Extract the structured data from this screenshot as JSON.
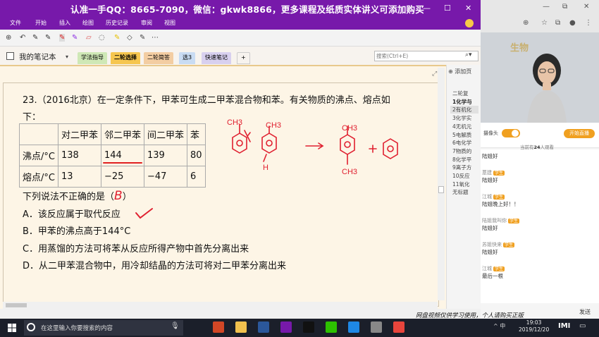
{
  "window": {
    "banner_title": "认准一手QQ：8665-7090，微信：gkwk8866，更多课程及纸质实体讲义可添加购买",
    "controls": [
      "—",
      "☐",
      "✕"
    ]
  },
  "menu": [
    "文件",
    "开始",
    "插入",
    "绘图",
    "历史记录",
    "审阅",
    "视图"
  ],
  "notebook": {
    "name": "我的笔记本",
    "tabs": [
      {
        "label": "学法指导",
        "color": "#cfe8b6"
      },
      {
        "label": "二轮选择",
        "color": "#f6c64f"
      },
      {
        "label": "二轮简答",
        "color": "#f3cda2"
      },
      {
        "label": "选3",
        "color": "#c9dcf3"
      },
      {
        "label": "快速笔记",
        "color": "#d8d0ef"
      },
      {
        "label": "+",
        "color": "#f7f3ee"
      }
    ],
    "search_placeholder": "搜索(Ctrl+E)"
  },
  "question": {
    "stem_line1": "23.（2016北京）在一定条件下，甲苯可生成二甲苯混合物和苯。有关物质的沸点、熔点如",
    "stem_line2": "下：",
    "table": {
      "header": [
        "",
        "对二甲苯",
        "邻二甲苯",
        "间二甲苯",
        "苯"
      ],
      "rows": [
        [
          "沸点/°C",
          "138",
          "144",
          "139",
          "80"
        ],
        [
          "熔点/°C",
          "13",
          "−25",
          "−47",
          "6"
        ]
      ]
    },
    "prompt": "下列说法不正确的是（",
    "prompt_end": "）",
    "answer_handwritten": "B",
    "options": [
      "A．该反应属于取代反应",
      "B．甲苯的沸点高于144°C",
      "C．用蒸馏的方法可将苯从反应所得产物中首先分离出来",
      "D．从二甲苯混合物中，用冷却结晶的方法可将对二甲苯分离出来"
    ],
    "sketch_labels": [
      "CH3",
      "CH3",
      "H",
      "CH3",
      "CH3"
    ]
  },
  "pages": {
    "add_label": "添加页",
    "items": [
      {
        "label": "二轮复",
        "style": ""
      },
      {
        "label": "1化学与",
        "style": "bold"
      },
      {
        "label": "2有机化",
        "style": "sel"
      },
      {
        "label": "3化学实",
        "style": ""
      },
      {
        "label": "4无机元",
        "style": ""
      },
      {
        "label": "5电解质",
        "style": ""
      },
      {
        "label": "6电化学",
        "style": ""
      },
      {
        "label": "7物质的",
        "style": ""
      },
      {
        "label": "8化学平",
        "style": ""
      },
      {
        "label": "9离子方",
        "style": ""
      },
      {
        "label": "10反应",
        "style": ""
      },
      {
        "label": "11氧化",
        "style": ""
      },
      {
        "label": "无标题",
        "style": ""
      }
    ]
  },
  "live": {
    "video_text": "生物",
    "camera_label": "摄像头",
    "go_live_label": "开始直播",
    "viewers_prefix": "当前有",
    "viewers_count": "24",
    "viewers_suffix": "人观看",
    "chat": [
      {
        "name": "",
        "msg": "陆姐好",
        "badge": ""
      },
      {
        "name": "蒽建",
        "msg": "陆姐好",
        "badge": "学生"
      },
      {
        "name": "江城",
        "msg": "陆姐晚上好！！",
        "badge": "学生"
      },
      {
        "name": "陆姐我叫你",
        "msg": "陆姐好",
        "badge": "学生"
      },
      {
        "name": "苏姐快来",
        "msg": "陆姐好",
        "badge": "学生"
      },
      {
        "name": "江城",
        "msg": "最后一根",
        "badge": "学生"
      }
    ],
    "send_label": "发送",
    "watermark": "网盘视频仅供学习使用，个人请购买正版"
  },
  "taskbar": {
    "search_placeholder": "在这里输入你要搜索的内容",
    "tray_text": "^ 中",
    "time": "19:03",
    "date": "2019/12/20",
    "apps": [
      {
        "name": "powerpoint-app",
        "color": "#d24726"
      },
      {
        "name": "explorer-app",
        "color": "#f2c14e"
      },
      {
        "name": "word-app",
        "color": "#2b579a"
      },
      {
        "name": "onenote-app",
        "color": "#7719aa"
      },
      {
        "name": "qq-app",
        "color": "#111111"
      },
      {
        "name": "wechat-app",
        "color": "#2dc100"
      },
      {
        "name": "edge-app",
        "color": "#1e88e5"
      },
      {
        "name": "media-app",
        "color": "#888888"
      },
      {
        "name": "chrome-app",
        "color": "#e8453c"
      }
    ]
  }
}
